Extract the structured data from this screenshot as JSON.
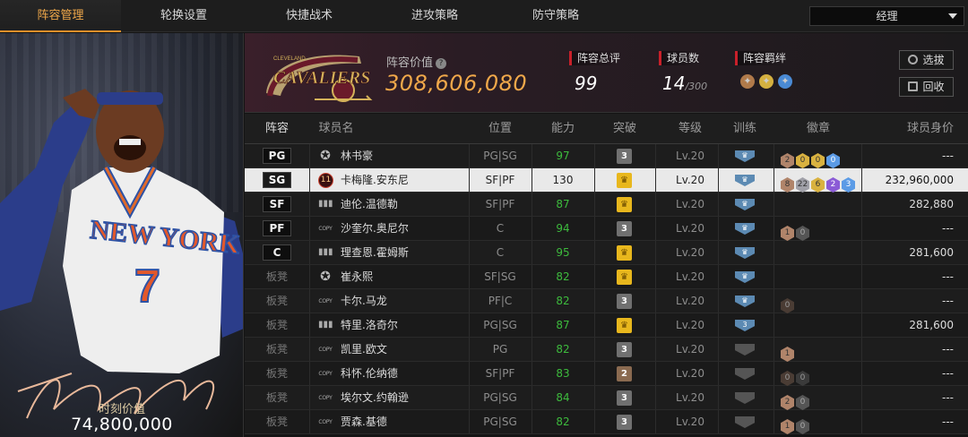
{
  "tabs": [
    {
      "label": "阵容管理",
      "active": true
    },
    {
      "label": "轮换设置",
      "active": false
    },
    {
      "label": "快捷战术",
      "active": false
    },
    {
      "label": "进攻策略",
      "active": false
    },
    {
      "label": "防守策略",
      "active": false
    }
  ],
  "role_select": {
    "value": "经理"
  },
  "featured": {
    "value_label": "时刻价值",
    "value": "74,800,000",
    "jersey_team": "NEW YORK",
    "jersey_number": "7"
  },
  "team": {
    "logo_text": "CAVALIERS",
    "logo_sub": "CLEVELAND",
    "value_label": "阵容价值",
    "value": "308,606,080",
    "rating_label": "阵容总评",
    "rating": "99",
    "players_label": "球员数",
    "players": "14",
    "players_max": "/300",
    "bond_label": "阵容羁绊"
  },
  "buttons": {
    "pick": "选拔",
    "recycle": "回收"
  },
  "columns": [
    "阵容",
    "球员名",
    "位置",
    "能力",
    "突破",
    "等级",
    "训练",
    "徽章",
    "球员身价"
  ],
  "rows": [
    {
      "slot": "PG",
      "icon": "star",
      "name": "林书豪",
      "pos": "PG|SG",
      "ability": "97",
      "break": "3",
      "level": "Lv.20",
      "train": "crown",
      "badges": [
        [
          "2",
          "h-br"
        ],
        [
          "0",
          "h-go"
        ],
        [
          "0",
          "h-go"
        ],
        [
          "0",
          "h-bl"
        ]
      ],
      "salary": "---",
      "sel": false
    },
    {
      "slot": "SG",
      "icon": "11",
      "name": "卡梅隆.安东尼",
      "pos": "SF|PF",
      "ability": "130",
      "break": "crown",
      "level": "Lv.20",
      "train": "crown",
      "badges": [
        [
          "8",
          "h-br"
        ],
        [
          "22",
          "h-si"
        ],
        [
          "6",
          "h-go"
        ],
        [
          "2",
          "h-pu"
        ],
        [
          "3",
          "h-bl"
        ]
      ],
      "salary": "232,960,000",
      "sel": true
    },
    {
      "slot": "SF",
      "icon": "bars",
      "name": "迪伦.温德勒",
      "pos": "SF|PF",
      "ability": "87",
      "break": "crown",
      "level": "Lv.20",
      "train": "crown",
      "badges": [],
      "salary": "282,880",
      "sel": false
    },
    {
      "slot": "PF",
      "icon": "copy",
      "name": "沙奎尔.奥尼尔",
      "pos": "C",
      "ability": "94",
      "break": "3",
      "level": "Lv.20",
      "train": "crown",
      "badges": [
        [
          "1",
          "h-br"
        ],
        [
          "0",
          "h-dsi"
        ]
      ],
      "salary": "---",
      "sel": false
    },
    {
      "slot": "C",
      "icon": "bars",
      "name": "理查恩.霍姆斯",
      "pos": "C",
      "ability": "95",
      "break": "crown",
      "level": "Lv.20",
      "train": "crown",
      "badges": [],
      "salary": "281,600",
      "sel": false
    },
    {
      "slot": "板凳",
      "icon": "star",
      "name": "崔永熙",
      "pos": "SF|SG",
      "ability": "82",
      "break": "crown",
      "level": "Lv.20",
      "train": "crown",
      "badges": [],
      "salary": "---",
      "sel": false
    },
    {
      "slot": "板凳",
      "icon": "copy",
      "name": "卡尔.马龙",
      "pos": "PF|C",
      "ability": "82",
      "break": "3",
      "level": "Lv.20",
      "train": "crown",
      "badges": [
        [
          "0",
          "h-dk"
        ]
      ],
      "salary": "---",
      "sel": false
    },
    {
      "slot": "板凳",
      "icon": "bars",
      "name": "特里.洛奇尔",
      "pos": "PG|SG",
      "ability": "87",
      "break": "crown",
      "level": "Lv.20",
      "train": "3",
      "badges": [],
      "salary": "281,600",
      "sel": false
    },
    {
      "slot": "板凳",
      "icon": "copy",
      "name": "凯里.欧文",
      "pos": "PG",
      "ability": "82",
      "break": "3",
      "level": "Lv.20",
      "train": "grey",
      "badges": [
        [
          "1",
          "h-br"
        ]
      ],
      "salary": "---",
      "sel": false
    },
    {
      "slot": "板凳",
      "icon": "copy",
      "name": "科怀.伦纳德",
      "pos": "SF|PF",
      "ability": "83",
      "break": "2",
      "level": "Lv.20",
      "train": "grey",
      "badges": [
        [
          "0",
          "h-dk"
        ],
        [
          "0",
          "h-dg"
        ]
      ],
      "salary": "---",
      "sel": false
    },
    {
      "slot": "板凳",
      "icon": "copy",
      "name": "埃尔文.约翰逊",
      "pos": "PG|SG",
      "ability": "84",
      "break": "3",
      "level": "Lv.20",
      "train": "grey",
      "badges": [
        [
          "2",
          "h-br"
        ],
        [
          "0",
          "h-dsi"
        ]
      ],
      "salary": "---",
      "sel": false
    },
    {
      "slot": "板凳",
      "icon": "copy",
      "name": "贾森.基德",
      "pos": "PG|SG",
      "ability": "82",
      "break": "3",
      "level": "Lv.20",
      "train": "grey",
      "badges": [
        [
          "1",
          "h-br"
        ],
        [
          "0",
          "h-dsi"
        ]
      ],
      "salary": "---",
      "sel": false
    }
  ],
  "colors": {
    "accent": "#f0a84a",
    "ability_green": "#3dbb3d",
    "highlight_row": "#e9e9e9",
    "stat_marker": "#c8202a"
  }
}
